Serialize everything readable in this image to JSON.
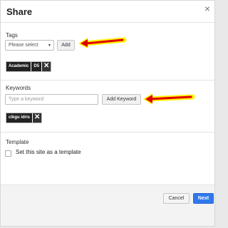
{
  "dialog": {
    "title": "Share",
    "close_icon": "×"
  },
  "tags": {
    "section_label": "Tags",
    "select_value": "Please select",
    "add_label": "Add",
    "chips": [
      {
        "segments": [
          "Academic",
          "D5"
        ]
      }
    ]
  },
  "keywords": {
    "section_label": "Keywords",
    "placeholder": "Type a keyword",
    "add_label": "Add Keyword",
    "chips": [
      {
        "segments": [
          "cikgu idris"
        ]
      }
    ]
  },
  "template": {
    "section_label": "Template",
    "checkbox_label": "Set this site as a template",
    "checked": false
  },
  "footer": {
    "cancel_label": "Cancel",
    "next_label": "Next"
  },
  "colors": {
    "primary": "#3079ed",
    "annotation_arrow": "#e00000",
    "annotation_glow": "#fff200"
  }
}
